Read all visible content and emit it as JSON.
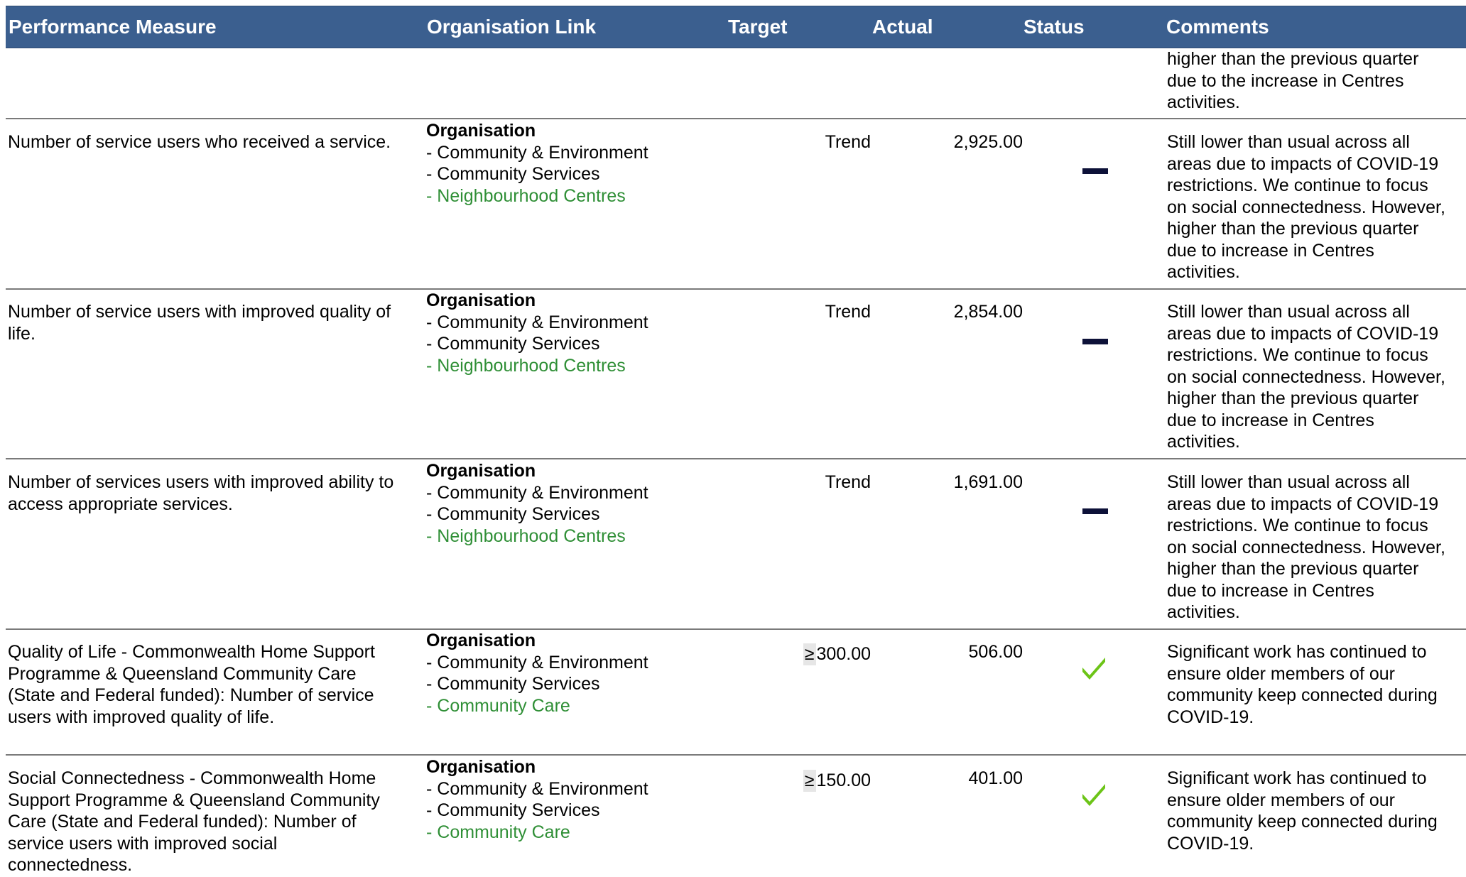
{
  "headers": {
    "measure": "Performance Measure",
    "org": "Organisation Link",
    "target": "Target",
    "actual": "Actual",
    "status": "Status",
    "comments": "Comments"
  },
  "carryover_comment": [
    "higher than the previous quarter",
    "due to the increase in Centres",
    "activities."
  ],
  "rows": [
    {
      "measure": [
        "Number of service users who received a service."
      ],
      "org": {
        "title": "Organisation",
        "lines": [
          "- Community & Environment",
          "- Community Services"
        ],
        "leaf": "- Neighbourhood Centres"
      },
      "target_symbol": "",
      "target": "Trend",
      "actual": "2,925.00",
      "status": "dash-icon",
      "comment": [
        "Still lower than usual across all",
        "areas due to impacts of COVID-19",
        "restrictions. We continue to focus",
        "on social connectedness. However,",
        "higher than the previous quarter",
        "due to increase in Centres",
        "activities."
      ]
    },
    {
      "measure": [
        "Number of service users with improved quality of",
        "life."
      ],
      "org": {
        "title": "Organisation",
        "lines": [
          "- Community & Environment",
          "- Community Services"
        ],
        "leaf": "- Neighbourhood Centres"
      },
      "target_symbol": "",
      "target": "Trend",
      "actual": "2,854.00",
      "status": "dash-icon",
      "comment": [
        "Still lower than usual across all",
        "areas due to impacts of COVID-19",
        "restrictions. We continue to focus",
        "on social connectedness. However,",
        "higher than the previous quarter",
        "due to increase in Centres",
        "activities."
      ]
    },
    {
      "measure": [
        "Number of services users with improved ability to",
        "access appropriate services."
      ],
      "org": {
        "title": "Organisation",
        "lines": [
          "- Community & Environment",
          "- Community Services"
        ],
        "leaf": "- Neighbourhood Centres"
      },
      "target_symbol": "",
      "target": "Trend",
      "actual": "1,691.00",
      "status": "dash-icon",
      "comment": [
        "Still lower than usual across all",
        "areas due to impacts of COVID-19",
        "restrictions. We continue to focus",
        "on social connectedness. However,",
        "higher than the previous quarter",
        "due to increase in Centres",
        "activities."
      ]
    },
    {
      "measure": [
        "Quality of Life - Commonwealth Home Support",
        "Programme & Queensland Community Care",
        "(State and Federal funded): Number of service",
        "users with improved quality of life."
      ],
      "org": {
        "title": "Organisation",
        "lines": [
          "- Community & Environment",
          "- Community Services"
        ],
        "leaf": "- Community Care"
      },
      "target_symbol": "≥",
      "target": "300.00",
      "actual": "506.00",
      "status": "check-icon",
      "comment": [
        "Significant work has continued to",
        "ensure older members of our",
        "community keep connected during",
        "COVID-19."
      ]
    },
    {
      "measure": [
        "Social Connectedness - Commonwealth Home",
        "Support Programme & Queensland Community",
        "Care (State and Federal funded): Number of",
        "service users with improved social",
        "connectedness."
      ],
      "org": {
        "title": "Organisation",
        "lines": [
          "- Community & Environment",
          "- Community Services"
        ],
        "leaf": "- Community Care"
      },
      "target_symbol": "≥",
      "target": "150.00",
      "actual": "401.00",
      "status": "check-icon",
      "comment": [
        "Significant work has continued to",
        "ensure older members of our",
        "community keep connected during",
        "COVID-19."
      ]
    }
  ],
  "colors": {
    "header_bg": "#3b5f8f",
    "leaf_text": "#2f8f36",
    "dash": "#0d1138",
    "check": "#6cc417"
  }
}
